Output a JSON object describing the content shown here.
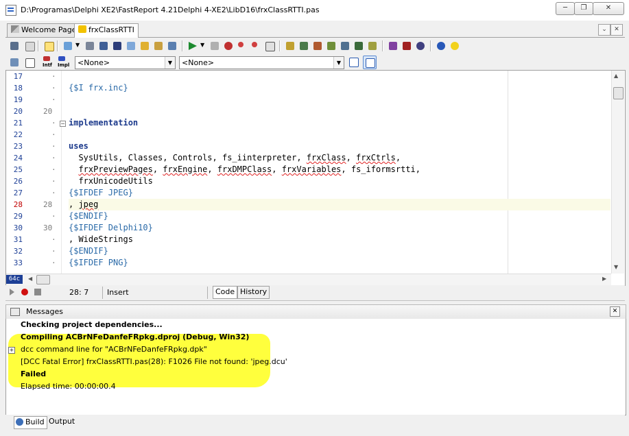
{
  "window": {
    "title": "D:\\Programas\\Delphi XE2\\FastReport 4.21Delphi 4-XE2\\LibD16\\frxClassRTTI.pas",
    "controls": [
      "minimize",
      "restore",
      "close"
    ]
  },
  "tabs": [
    {
      "label": "Welcome Page",
      "icon": "home-icon",
      "active": false
    },
    {
      "label": "frxClassRTTI",
      "icon": "unit-file-icon",
      "active": true
    }
  ],
  "toolbar2": {
    "intf_label": "Intf",
    "impl_label": "Impl",
    "combo1": "<None>",
    "combo2": "<None>"
  },
  "editor": {
    "lines": [
      {
        "num": "17",
        "gutter": "",
        "text": ""
      },
      {
        "num": "18",
        "gutter": "",
        "text": "{$I frx.inc}"
      },
      {
        "num": "19",
        "gutter": "",
        "text": ""
      },
      {
        "num": "20",
        "gutter": "20",
        "text": ""
      },
      {
        "num": "21",
        "gutter": "",
        "text": "implementation"
      },
      {
        "num": "22",
        "gutter": "",
        "text": ""
      },
      {
        "num": "23",
        "gutter": "",
        "text": "uses"
      },
      {
        "num": "24",
        "gutter": "",
        "text": "  SysUtils, Classes, Controls, fs_iinterpreter, frxClass, frxCtrls,"
      },
      {
        "num": "25",
        "gutter": "",
        "text": "  frxPreviewPages, frxEngine, frxDMPClass, frxVariables, fs_iformsrtti,"
      },
      {
        "num": "26",
        "gutter": "",
        "text": "  frxUnicodeUtils"
      },
      {
        "num": "27",
        "gutter": "",
        "text": "{$IFDEF JPEG}"
      },
      {
        "num": "28",
        "gutter": "28",
        "text": ", jpeg"
      },
      {
        "num": "29",
        "gutter": "",
        "text": "{$ENDIF}"
      },
      {
        "num": "30",
        "gutter": "30",
        "text": "{$IFDEF Delphi10}"
      },
      {
        "num": "31",
        "gutter": "",
        "text": ", WideStrings"
      },
      {
        "num": "32",
        "gutter": "",
        "text": "{$ENDIF}"
      },
      {
        "num": "33",
        "gutter": "",
        "text": "{$IFDEF PNG}"
      }
    ],
    "encoding_badge": "64c"
  },
  "status": {
    "position": "28:  7",
    "mode": "Insert",
    "tab_code": "Code",
    "tab_history": "History"
  },
  "messages": {
    "title": "Messages",
    "lines": [
      {
        "text": "Checking project dependencies...",
        "bold": true
      },
      {
        "text": "Compiling ACBrNFeDanfeFRpkg.dproj (Debug, Win32)",
        "bold": true
      },
      {
        "text": "dcc command line for \"ACBrNFeDanfeFRpkg.dpk\"",
        "bold": false
      },
      {
        "text": "[DCC Fatal Error] frxClassRTTI.pas(28): F1026 File not found: 'jpeg.dcu'",
        "bold": false
      },
      {
        "text": "Failed",
        "bold": true
      },
      {
        "text": "Elapsed time: 00:00:00.4",
        "bold": false
      }
    ],
    "highlight_color": "#ffff33"
  },
  "bottom_tabs": [
    {
      "label": "Build",
      "active": true
    },
    {
      "label": "Output",
      "active": false
    }
  ]
}
